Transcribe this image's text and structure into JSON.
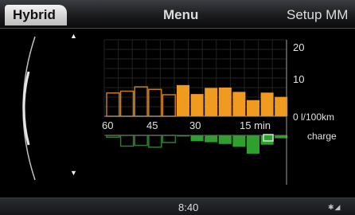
{
  "header": {
    "tab_label": "Hybrid",
    "title": "Menu",
    "right_label": "Setup MM"
  },
  "footer": {
    "time": "8:40"
  },
  "chart_data": {
    "type": "bar",
    "x_tick_labels": [
      "60",
      "45",
      "30",
      "15 min"
    ],
    "y_tick_labels": [
      "20",
      "10",
      "0 l/100km"
    ],
    "lower_label": "charge",
    "ylim": [
      0,
      20
    ],
    "grid": true,
    "series": [
      {
        "name": "consumption_history",
        "style": "outline",
        "color": "#c37a1c",
        "values": [
          6.5,
          7.0,
          8.2,
          7.5,
          6.0
        ]
      },
      {
        "name": "consumption_recent",
        "style": "filled",
        "color": "#f09a20",
        "values": [
          8.7,
          6.2,
          7.9,
          8.0,
          6.8,
          4.5,
          6.6,
          5.4
        ]
      },
      {
        "name": "charge_history",
        "style": "outline",
        "color": "#2f7a2f",
        "values": [
          -0.5,
          -3.0,
          -2.8,
          -3.3,
          -2.0
        ]
      },
      {
        "name": "charge_recent",
        "style": "filled",
        "color": "#2da02d",
        "values": [
          -0.3,
          -1.6,
          -1.9,
          -2.4,
          -3.2,
          -5.1,
          -2.6,
          -0.8
        ]
      }
    ]
  }
}
